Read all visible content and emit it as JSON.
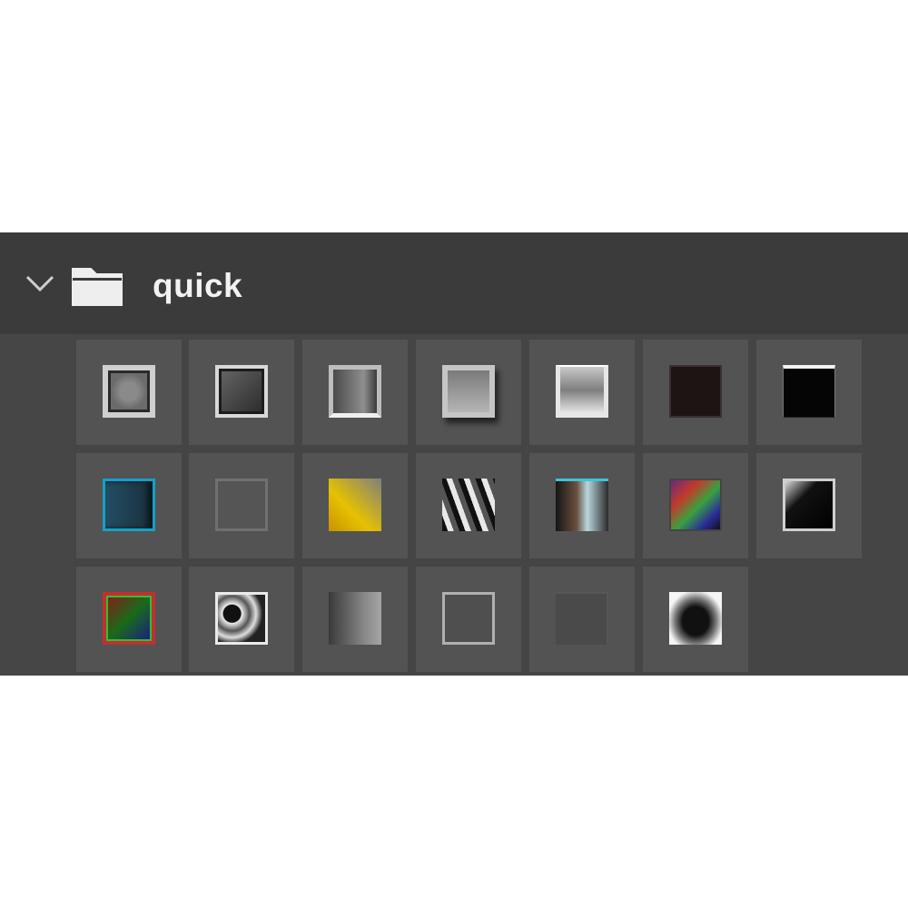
{
  "folder": {
    "name": "quick",
    "expanded": true,
    "chevron_icon": "chevron-down-icon",
    "folder_icon": "folder-icon"
  },
  "presets": [
    {
      "style": "chrome-frame"
    },
    {
      "style": "dark-bevel"
    },
    {
      "style": "gradient-bevel"
    },
    {
      "style": "chrome-frame-shadow"
    },
    {
      "style": "glass-cup"
    },
    {
      "style": "dark-brown-solid"
    },
    {
      "style": "black-solid-white-rim"
    },
    {
      "style": "blue-glow"
    },
    {
      "style": "subtle-outline"
    },
    {
      "style": "gold-gradient"
    },
    {
      "style": "streak-chrome"
    },
    {
      "style": "copper-sheen"
    },
    {
      "style": "rainbow-foil"
    },
    {
      "style": "black-glossy-rim"
    },
    {
      "style": "rainbow-frame"
    },
    {
      "style": "marble-chrome"
    },
    {
      "style": "soft-gray-gradient"
    },
    {
      "style": "thin-outline"
    },
    {
      "style": "faint-ghost"
    },
    {
      "style": "white-dark-blob"
    }
  ]
}
